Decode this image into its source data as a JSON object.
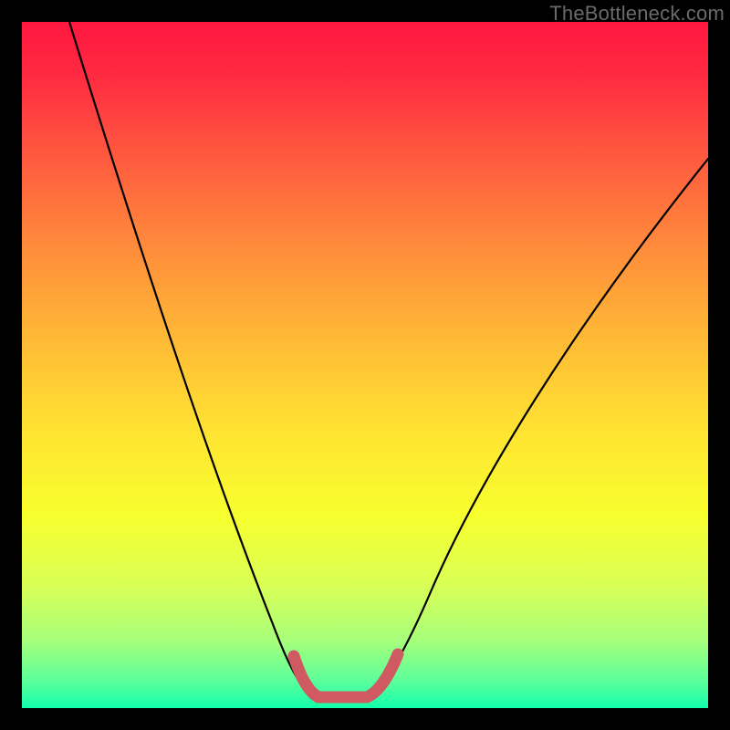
{
  "watermark": "TheBottleneck.com",
  "chart_data": {
    "type": "line",
    "title": "",
    "xlabel": "",
    "ylabel": "",
    "xlim": [
      0,
      100
    ],
    "ylim": [
      0,
      100
    ],
    "series": [
      {
        "name": "curve",
        "color": "#000000",
        "x": [
          7,
          10,
          14,
          18,
          22,
          26,
          30,
          33,
          36,
          38,
          40,
          42,
          45,
          50,
          53,
          55,
          58,
          62,
          68,
          76,
          86,
          96,
          100
        ],
        "y": [
          100,
          92,
          82,
          72,
          62,
          52,
          42,
          34,
          26,
          20,
          14,
          9,
          3,
          3,
          5,
          9,
          15,
          24,
          36,
          50,
          64,
          76,
          80
        ]
      },
      {
        "name": "bottom-highlight",
        "color": "#cf5a62",
        "x": [
          40,
          42,
          45,
          50,
          53,
          55
        ],
        "y": [
          8,
          4,
          2,
          2,
          4,
          8
        ]
      }
    ],
    "gradient_stops": [
      {
        "pos": 0,
        "color": "#ff163f"
      },
      {
        "pos": 8,
        "color": "#ff2b41"
      },
      {
        "pos": 20,
        "color": "#ff5b3f"
      },
      {
        "pos": 33,
        "color": "#ff8c3b"
      },
      {
        "pos": 46,
        "color": "#ffb936"
      },
      {
        "pos": 60,
        "color": "#ffe431"
      },
      {
        "pos": 72,
        "color": "#f7ff2e"
      },
      {
        "pos": 82,
        "color": "#d9ff55"
      },
      {
        "pos": 90,
        "color": "#a8ff7a"
      },
      {
        "pos": 96,
        "color": "#5dff9b"
      },
      {
        "pos": 100,
        "color": "#12ffab"
      }
    ]
  }
}
